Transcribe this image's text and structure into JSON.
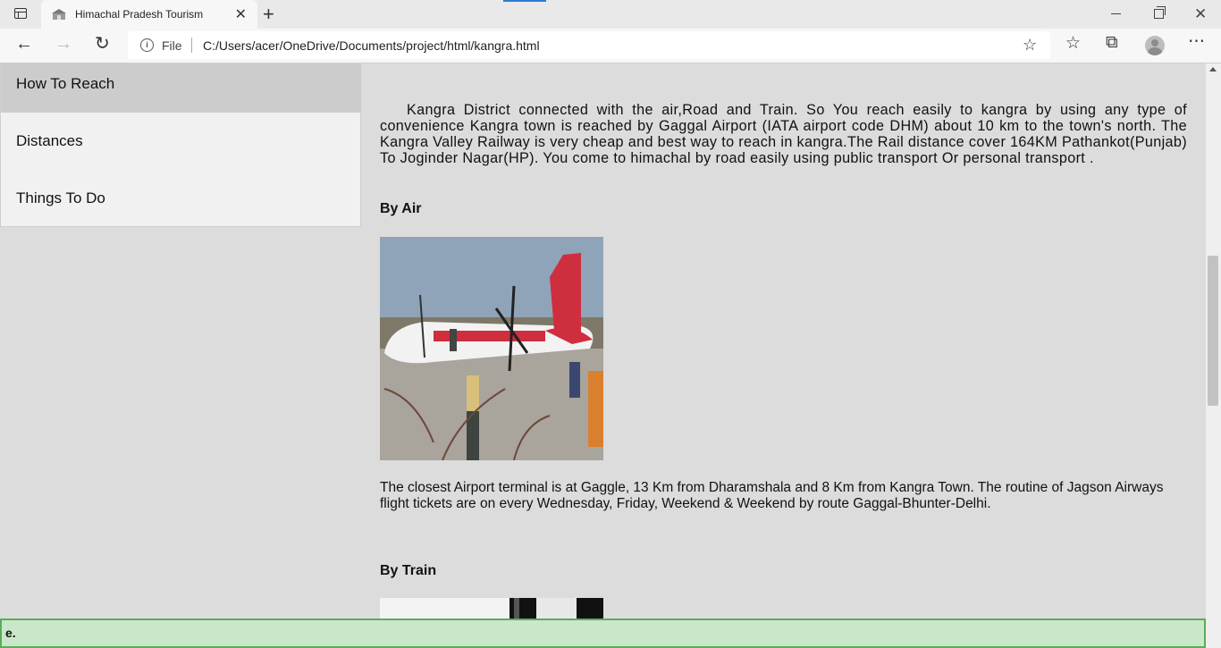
{
  "browser": {
    "tab_title": "Himachal Pradesh Tourism",
    "address_label": "File",
    "url": "C:/Users/acer/OneDrive/Documents/project/html/kangra.html"
  },
  "sidebar": {
    "items": [
      {
        "label": "How To Reach",
        "active": true
      },
      {
        "label": "Distances",
        "active": false
      },
      {
        "label": "Things To Do",
        "active": false
      }
    ]
  },
  "content": {
    "intro": "Kangra District connected with the air,Road and Train. So You reach easily to kangra by using any type of convenience Kangra town is reached by Gaggal Airport (IATA airport code DHM) about 10 km to the town's north. The Kangra Valley Railway is very cheap and best way to reach in kangra.The Rail distance cover 164KM Pathankot(Punjab) To Joginder Nagar(HP). You come to himachal by road easily using public transport Or personal transport .",
    "by_air_heading": "By Air",
    "by_air_text": "The closest Airport terminal is at Gaggle, 13 Km from Dharamshala and 8 Km from Kangra Town. The routine of Jagson Airways flight tickets are on every Wednesday, Friday, Weekend & Weekend by route Gaggal-Bhunter-Delhi.",
    "by_train_heading": "By Train"
  },
  "bottom_bar": {
    "text": "e."
  },
  "colors": {
    "accent": "#2b7cd3",
    "sidebar_active": "#cccccc",
    "bottom_bar_bg": "#c9e8c9",
    "bottom_bar_border": "#5cab5c"
  }
}
